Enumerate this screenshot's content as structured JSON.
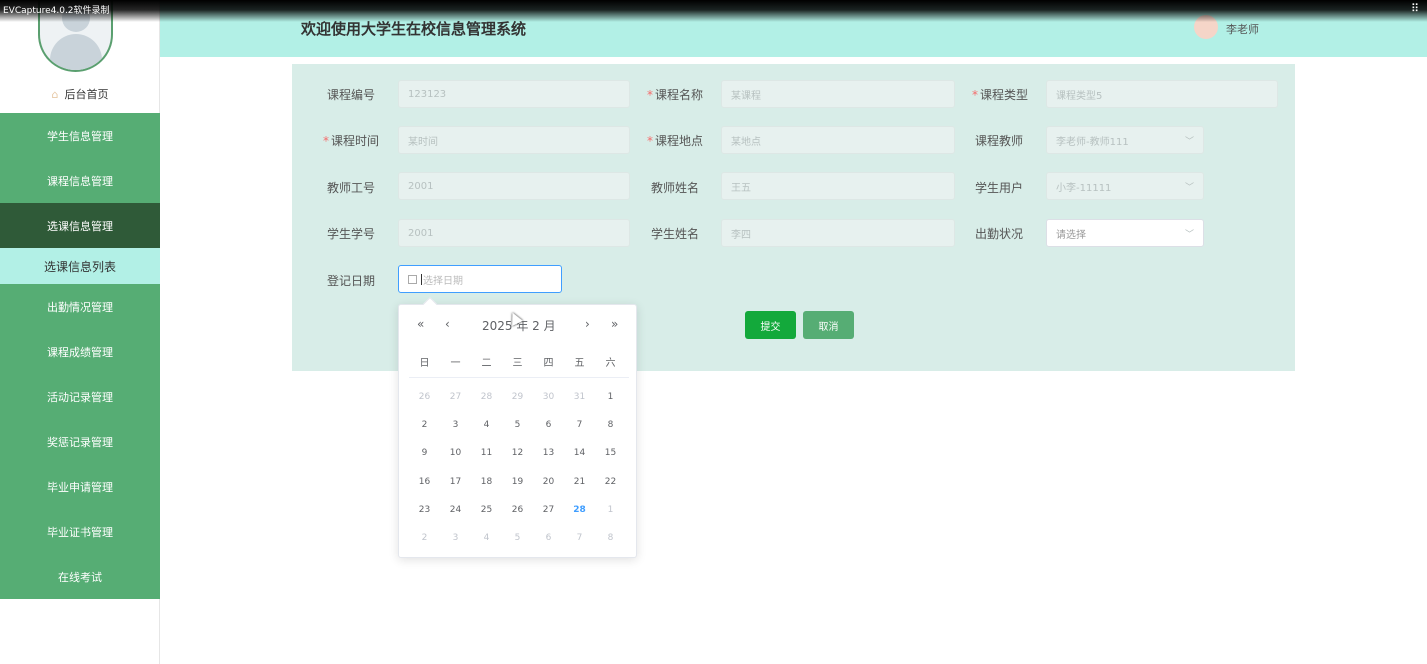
{
  "capture": {
    "label": "EVCapture4.0.2软件录制",
    "icon": "grip-icon"
  },
  "header": {
    "title": "欢迎使用大学生在校信息管理系统",
    "user": "李老师"
  },
  "sidebar": {
    "home": "后台首页",
    "menu": [
      "学生信息管理",
      "课程信息管理",
      "选课信息管理",
      "选课信息列表",
      "出勤情况管理",
      "课程成绩管理",
      "活动记录管理",
      "奖惩记录管理",
      "毕业申请管理",
      "毕业证书管理",
      "在线考试"
    ]
  },
  "form": {
    "labels": {
      "course_no": "课程编号",
      "course_name": "课程名称",
      "course_type": "课程类型",
      "course_time": "课程时间",
      "course_place": "课程地点",
      "course_teacher": "课程教师",
      "teacher_no": "教师工号",
      "teacher_name": "教师姓名",
      "student_user": "学生用户",
      "student_no": "学生学号",
      "student_name": "学生姓名",
      "attendance": "出勤状况",
      "reg_date": "登记日期"
    },
    "values": {
      "course_no": "123123",
      "course_name": "某课程",
      "course_type": "课程类型5",
      "course_time": "某时间",
      "course_place": "某地点",
      "course_teacher": "李老师-教师111",
      "teacher_no": "2001",
      "teacher_name": "王五",
      "student_user": "小李-11111",
      "student_no": "2001",
      "student_name": "李四",
      "attendance": "请选择",
      "reg_date": "选择日期"
    },
    "submit": "提交",
    "cancel": "取消"
  },
  "picker": {
    "title": "2025 年  2 月",
    "nav": {
      "prev_year": "«",
      "prev_month": "‹",
      "next_month": "›",
      "next_year": "»"
    },
    "weekdays": [
      "日",
      "一",
      "二",
      "三",
      "四",
      "五",
      "六"
    ],
    "weeks": [
      [
        "26",
        "27",
        "28",
        "29",
        "30",
        "31",
        "1"
      ],
      [
        "2",
        "3",
        "4",
        "5",
        "6",
        "7",
        "8"
      ],
      [
        "9",
        "10",
        "11",
        "12",
        "13",
        "14",
        "15"
      ],
      [
        "16",
        "17",
        "18",
        "19",
        "20",
        "21",
        "22"
      ],
      [
        "23",
        "24",
        "25",
        "26",
        "27",
        "28",
        "1"
      ],
      [
        "2",
        "3",
        "4",
        "5",
        "6",
        "7",
        "8"
      ]
    ],
    "today": "28"
  },
  "colors": {
    "header_bg": "#b2f0e6",
    "menu_bg": "#56ad74",
    "menu_active": "#2f5a38",
    "submit": "#13a93b",
    "required": "#f56c6c",
    "today": "#409eff"
  }
}
